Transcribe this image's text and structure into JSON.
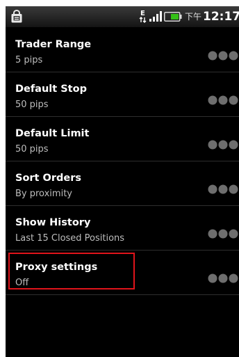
{
  "status_bar": {
    "network_type": "E",
    "ampm": "下午",
    "time": "12:17",
    "icons": [
      "shopping-bag-icon",
      "data-arrows-icon",
      "signal-icon",
      "battery-icon"
    ]
  },
  "settings": [
    {
      "title": "Trader Range",
      "summary": "5 pips"
    },
    {
      "title": "Default Stop",
      "summary": "50 pips"
    },
    {
      "title": "Default Limit",
      "summary": "50 pips"
    },
    {
      "title": "Sort Orders",
      "summary": "By proximity"
    },
    {
      "title": "Show History",
      "summary": "Last 15 Closed Positions"
    },
    {
      "title": "Proxy settings",
      "summary": "Off"
    }
  ],
  "colors": {
    "background": "#000000",
    "title": "#ffffff",
    "summary": "#bdbdbd",
    "highlight": "#e0141b",
    "battery": "#35c018"
  }
}
